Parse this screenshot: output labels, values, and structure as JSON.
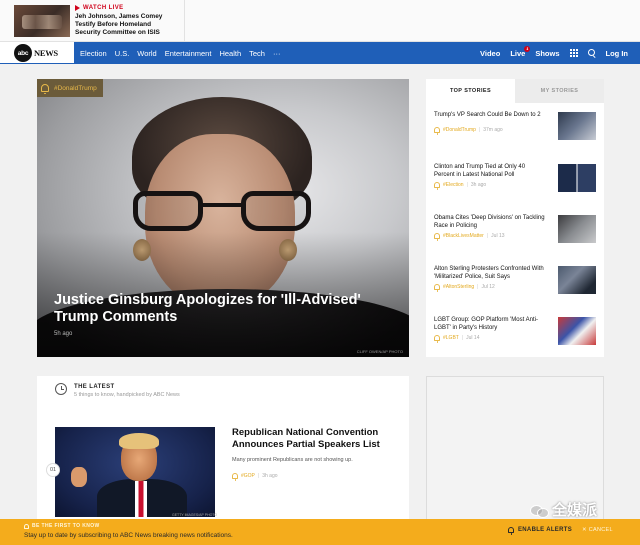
{
  "watch_live": {
    "label": "WATCH LIVE",
    "headline": "Jeh Johnson, James Comey Testify Before Homeland Security Committee on ISIS"
  },
  "brand": {
    "logo_text": "abc",
    "name": "NEWS"
  },
  "nav": {
    "items": [
      "Election",
      "U.S.",
      "World",
      "Entertainment",
      "Health",
      "Tech",
      "···"
    ],
    "right": {
      "video": "Video",
      "live": "Live",
      "live_badge": "1",
      "shows": "Shows",
      "login": "Log In"
    }
  },
  "hero": {
    "tag": "#DonaldTrump",
    "title": "Justice Ginsburg Apologizes for 'Ill-Advised' Trump Comments",
    "time": "5h ago",
    "credit": "CLIFF OWEN/AP PHOTO"
  },
  "stories": {
    "tabs": [
      "TOP STORIES",
      "MY STORIES"
    ],
    "active_tab": "TOP STORIES",
    "items": [
      {
        "title": "Trump's VP Search Could Be Down to 2",
        "tag": "#DonaldTrump",
        "time": "37m ago"
      },
      {
        "title": "Clinton and Trump Tied at Only 40 Percent in Latest National Poll",
        "tag": "#Election",
        "time": "3h ago"
      },
      {
        "title": "Obama Cites 'Deep Divisions' on Tackling Race in Policing",
        "tag": "#BlackLivesMatter",
        "time": "Jul 13"
      },
      {
        "title": "Alton Sterling Protesters Confronted With 'Militarized' Police, Suit Says",
        "tag": "#AltonSterling",
        "time": "Jul 12"
      },
      {
        "title": "LGBT Group: GOP Platform 'Most Anti-LGBT' in Party's History",
        "tag": "#LGBT",
        "time": "Jul 14"
      }
    ]
  },
  "latest": {
    "title": "THE LATEST",
    "subtitle": "5 things to know, handpicked by ABC News",
    "number": "01",
    "headline": "Republican National Convention Announces Partial Speakers List",
    "description": "Many prominent Republicans are not showing up.",
    "tag": "#GOP",
    "time": "3h ago",
    "credit": "GETTY IMAGES/AP PHOTO"
  },
  "alert": {
    "kicker": "BE THE FIRST TO KNOW",
    "text": "Stay up to date by subscribing to ABC News breaking news notifications.",
    "enable": "ENABLE ALERTS",
    "cancel": "✕ CANCEL"
  },
  "watermark": {
    "text": "全媒派"
  },
  "colors": {
    "nav_blue": "#1f5fb8",
    "alert_yellow": "#f4ac1c",
    "tag_gold": "#e3a91e",
    "live_red": "#d0021b"
  }
}
